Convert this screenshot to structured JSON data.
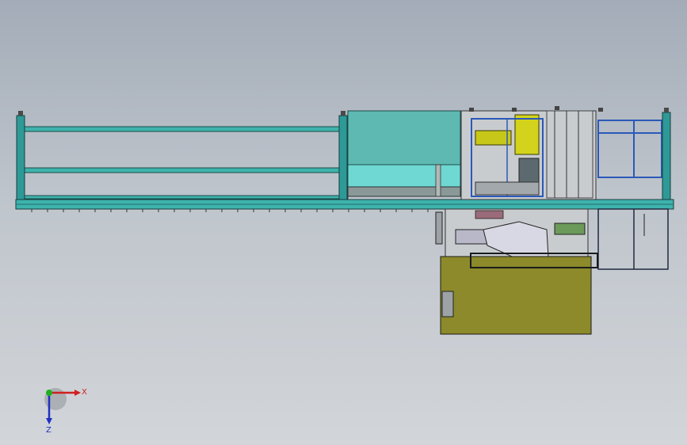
{
  "viewport": {
    "name": "cad-assembly-view",
    "colors": {
      "conveyor_frame": "#2e9a98",
      "conveyor_rail": "#3fb3ad",
      "cabinet_panel": "#5db9b2",
      "machine_base": "#8c8a2a",
      "guard_frame_blue": "#2a59b8",
      "outline_dark": "#1b1b1b",
      "yellow_part": "#c7c71a"
    }
  },
  "triad": {
    "x_label": "X",
    "z_label": "Z",
    "x_color": "#d02020",
    "y_color": "#20b020",
    "z_color": "#2030c0"
  }
}
